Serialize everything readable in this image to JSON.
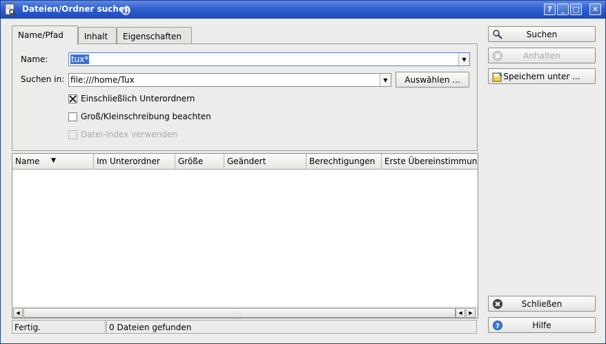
{
  "window": {
    "title": "Dateien/Ordner suchen",
    "controls": {
      "help": "?",
      "minimize": "_",
      "maximize": "□",
      "close": "✕"
    }
  },
  "tabs": [
    {
      "label": "Name/Pfad",
      "active": true
    },
    {
      "label": "Inhalt",
      "active": false
    },
    {
      "label": "Eigenschaften",
      "active": false
    }
  ],
  "form": {
    "name_label": "Name:",
    "name_value": "tux*",
    "search_in_label": "Suchen in:",
    "search_in_value": "file:///home/Tux",
    "browse_button": "Auswählen ...",
    "include_subfolders": {
      "label": "Einschließlich Unterordnern",
      "checked": true,
      "enabled": true
    },
    "case_sensitive": {
      "label": "Groß/Kleinschreibung beachten",
      "checked": false,
      "enabled": true
    },
    "use_file_index": {
      "label": "Datei-Index verwenden",
      "checked": false,
      "enabled": false
    }
  },
  "results": {
    "columns": [
      "Name",
      "Im Unterordner",
      "Größe",
      "Geändert",
      "Berechtigungen",
      "Erste Übereinstimmung"
    ],
    "rows": []
  },
  "status": {
    "state": "Fertig.",
    "count": "0 Dateien gefunden"
  },
  "actions": {
    "search": "Suchen",
    "stop": "Anhalten",
    "save_as": "Speichern unter ...",
    "close": "Schließen",
    "help": "Hilfe"
  }
}
